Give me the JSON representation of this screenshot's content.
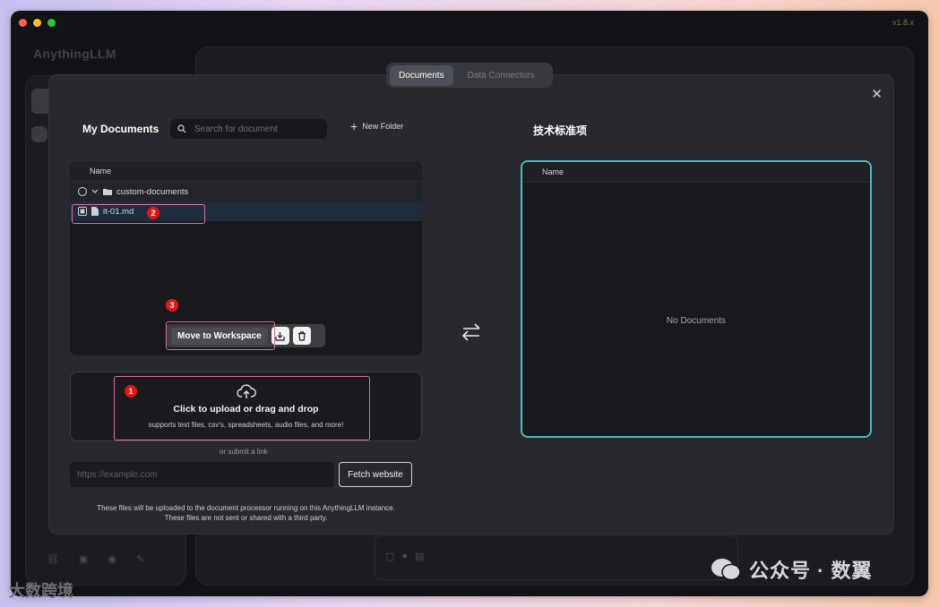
{
  "app": {
    "name": "AnythingLLM",
    "version": "v1.8.x"
  },
  "modal": {
    "tabs": [
      {
        "label": "Documents",
        "active": true
      },
      {
        "label": "Data Connectors",
        "active": false
      }
    ],
    "close_icon": "close-icon",
    "my_documents": {
      "title": "My Documents",
      "search_placeholder": "Search for document",
      "new_folder_label": "New Folder",
      "table_header": "Name",
      "folder": {
        "name": "custom-documents"
      },
      "file": {
        "name": "it-01.md",
        "selected": true
      },
      "actions": {
        "move_label": "Move to Workspace"
      }
    },
    "upload": {
      "title": "Click to upload or drag and drop",
      "subtitle": "supports text files, csv's, spreadsheets, audio files, and more!",
      "or_label": "or submit a link",
      "url_placeholder": "https://example.com",
      "fetch_label": "Fetch website",
      "disclaimer_line1": "These files will be uploaded to the document processor running on this AnythingLLM instance.",
      "disclaimer_line2": "These files are not sent or shared with a third party."
    },
    "workspace": {
      "title": "技术标准项",
      "table_header": "Name",
      "empty_text": "No Documents"
    },
    "annotations": [
      "1",
      "2",
      "3"
    ]
  },
  "watermarks": {
    "main": "公众号 · 数翼",
    "corner": "大数跨境"
  },
  "colors": {
    "highlight_outline": "#e36ba0",
    "workspace_outline": "#4fb9c6",
    "badge": "#e31414"
  }
}
